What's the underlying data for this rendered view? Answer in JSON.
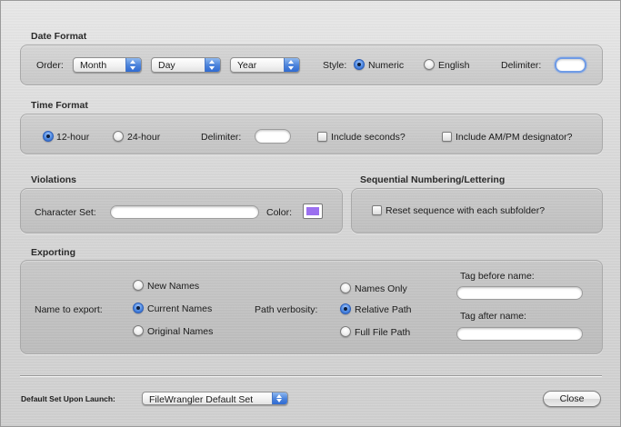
{
  "date_format": {
    "title": "Date Format",
    "order_label": "Order:",
    "order_popups": [
      "Month",
      "Day",
      "Year"
    ],
    "style_label": "Style:",
    "style_options": [
      {
        "label": "Numeric",
        "selected": true
      },
      {
        "label": "English",
        "selected": false
      }
    ],
    "delimiter_label": "Delimiter:",
    "delimiter_value": ""
  },
  "time_format": {
    "title": "Time Format",
    "clock_options": [
      {
        "label": "12-hour",
        "selected": true
      },
      {
        "label": "24-hour",
        "selected": false
      }
    ],
    "delimiter_label": "Delimiter:",
    "delimiter_value": "",
    "include_seconds": {
      "label": "Include seconds?",
      "checked": false
    },
    "include_ampm": {
      "label": "Include AM/PM designator?",
      "checked": false
    }
  },
  "violations": {
    "title": "Violations",
    "charset_label": "Character Set:",
    "charset_value": "",
    "color_label": "Color:",
    "color_value": "#9b6ff0"
  },
  "sequential": {
    "title": "Sequential Numbering/Lettering",
    "reset_option": {
      "label": "Reset sequence with each subfolder?",
      "checked": false
    }
  },
  "exporting": {
    "title": "Exporting",
    "name_label": "Name to export:",
    "name_options": [
      {
        "label": "New Names",
        "selected": false
      },
      {
        "label": "Current Names",
        "selected": true
      },
      {
        "label": "Original Names",
        "selected": false
      }
    ],
    "path_label": "Path verbosity:",
    "path_options": [
      {
        "label": "Names Only",
        "selected": false
      },
      {
        "label": "Relative Path",
        "selected": true
      },
      {
        "label": "Full File Path",
        "selected": false
      }
    ],
    "tag_before_label": "Tag before name:",
    "tag_before_value": "",
    "tag_after_label": "Tag after name:",
    "tag_after_value": ""
  },
  "footer": {
    "default_set_label": "Default Set Upon Launch:",
    "default_set_value": "FileWrangler Default Set",
    "close_label": "Close"
  }
}
